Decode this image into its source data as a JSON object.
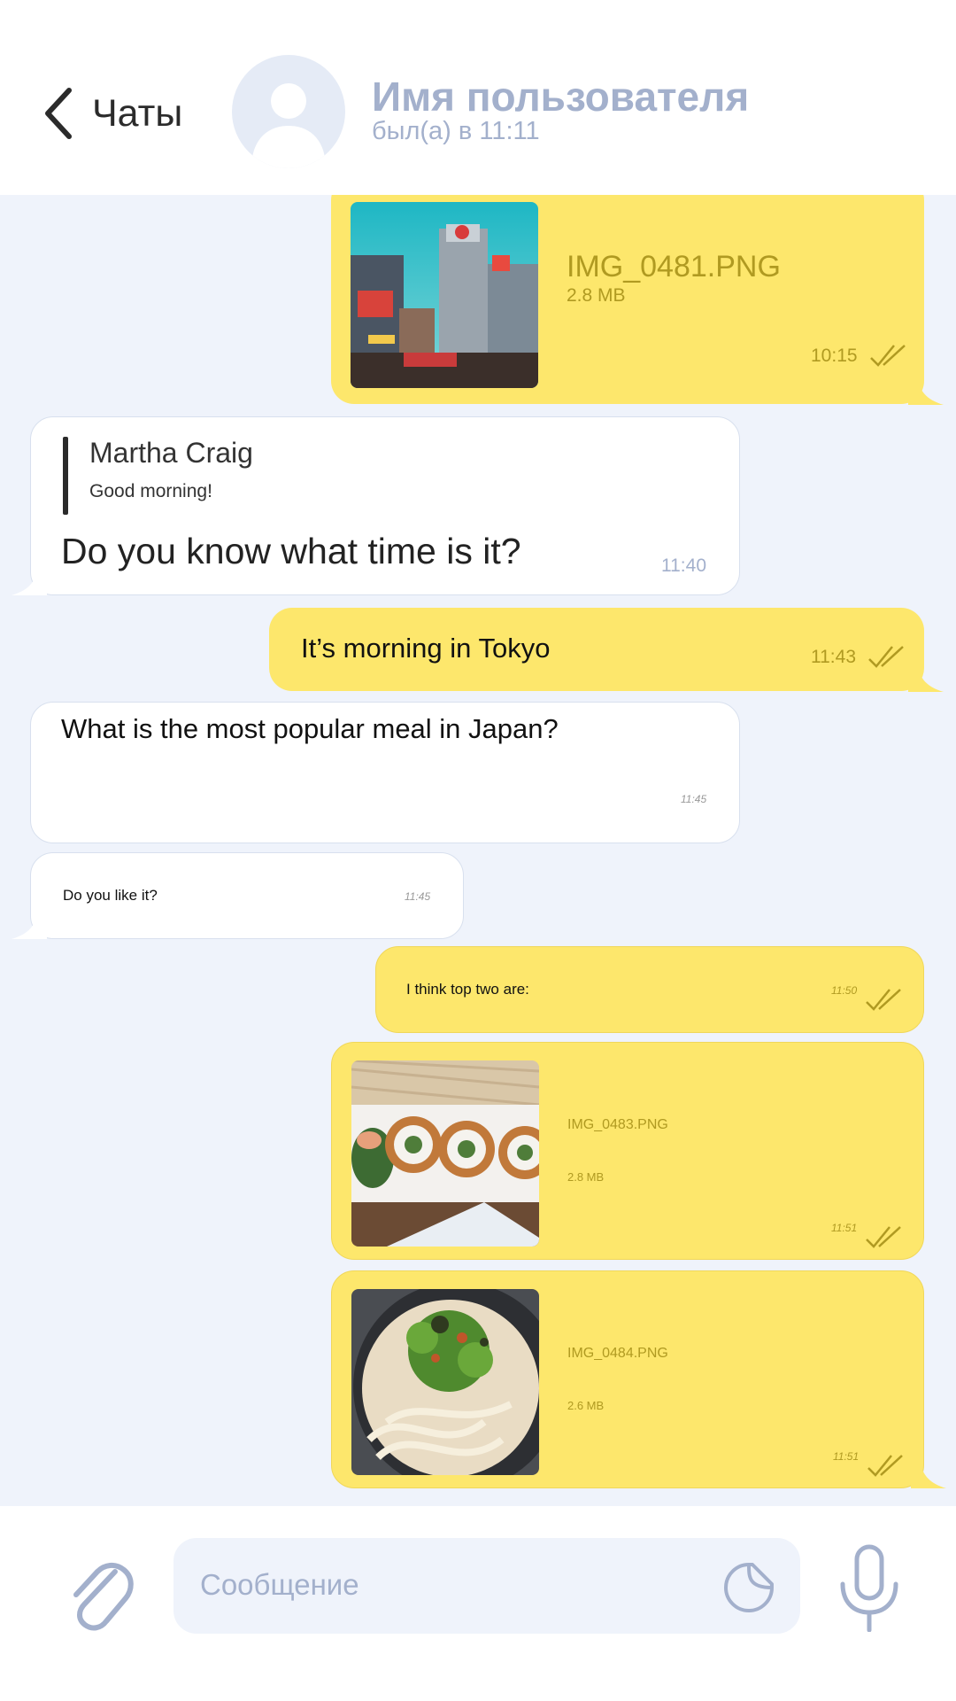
{
  "header": {
    "back_label": "Чаты",
    "user_name": "Имя пользователя",
    "user_status": "был(а) в 11:11"
  },
  "messages": [
    {
      "type": "file",
      "direction": "out",
      "file_name": "IMG_0481.PNG",
      "file_size": "2.8 MB",
      "time": "10:15",
      "status": "read"
    },
    {
      "type": "reply",
      "direction": "in",
      "reply_author": "Martha Craig",
      "reply_text": "Good morning!",
      "text": "Do you know what time is it?",
      "time": "11:40"
    },
    {
      "type": "text",
      "direction": "out",
      "text": "It’s morning in Tokyo",
      "time": "11:43",
      "status": "read"
    },
    {
      "type": "text",
      "direction": "in",
      "text": "What is the most popular meal in Japan?",
      "time": "11:45"
    },
    {
      "type": "text",
      "direction": "in",
      "text": "Do you like it?",
      "time": "11:45"
    },
    {
      "type": "text",
      "direction": "out",
      "text": "I think top two are:",
      "time": "11:50",
      "status": "read"
    },
    {
      "type": "file",
      "direction": "out",
      "file_name": "IMG_0483.PNG",
      "file_size": "2.8 MB",
      "time": "11:51",
      "status": "read"
    },
    {
      "type": "file",
      "direction": "out",
      "file_name": "IMG_0484.PNG",
      "file_size": "2.6 MB",
      "time": "11:51",
      "status": "read"
    }
  ],
  "footer": {
    "input_placeholder": "Сообщение",
    "attach_icon": "paperclip-icon",
    "sticker_icon": "sticker-icon",
    "mic_icon": "microphone-icon"
  },
  "colors": {
    "outgoing_bubble": "#fde76c",
    "incoming_bubble": "#ffffff",
    "chat_background": "#eff3fb",
    "accent_muted": "#a3b0cc",
    "outgoing_meta": "#b09a21"
  }
}
